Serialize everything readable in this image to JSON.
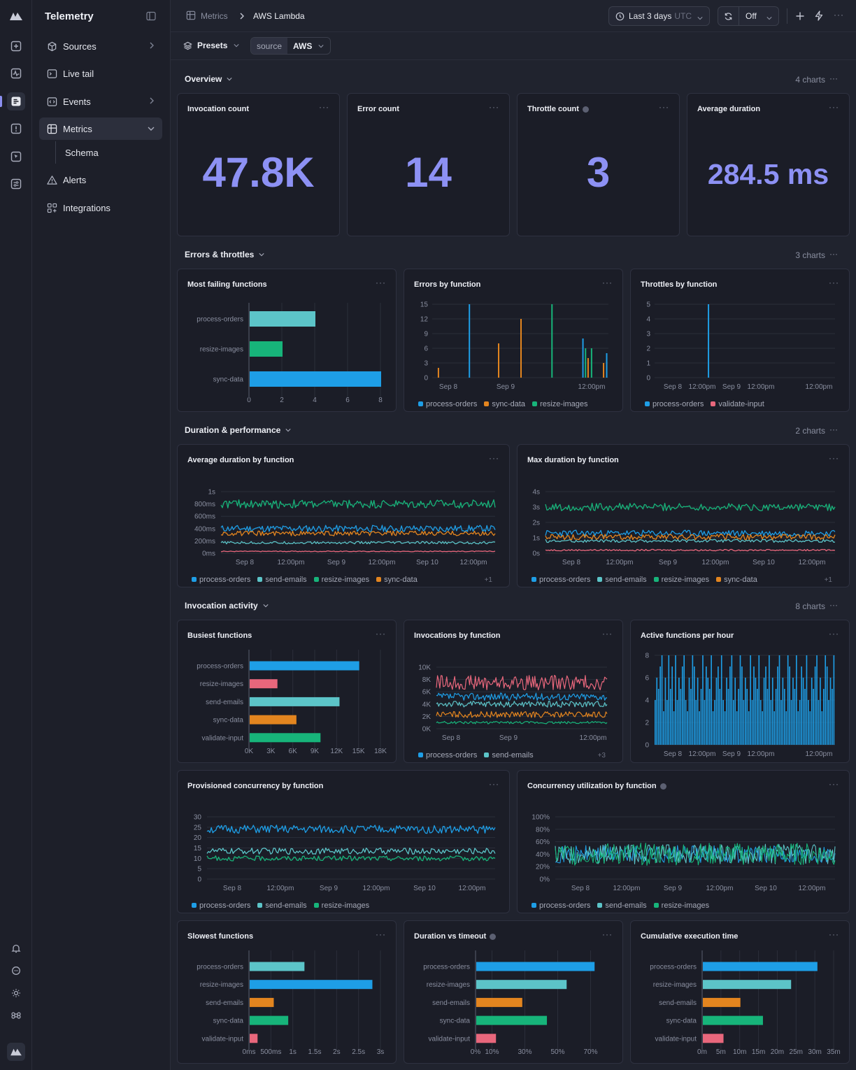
{
  "app": {
    "title": "Telemetry"
  },
  "sidebar": {
    "items": [
      {
        "label": "Sources",
        "icon": "cube-icon"
      },
      {
        "label": "Live tail",
        "icon": "terminal-icon"
      },
      {
        "label": "Events",
        "icon": "code-icon"
      },
      {
        "label": "Metrics",
        "icon": "grid-icon"
      },
      {
        "label": "Schema",
        "icon": ""
      },
      {
        "label": "Alerts",
        "icon": "alert-triangle-icon"
      },
      {
        "label": "Integrations",
        "icon": "integrations-icon"
      }
    ]
  },
  "header": {
    "breadcrumb": [
      "Metrics",
      "AWS Lambda"
    ],
    "time_range": "Last 3 days",
    "timezone": "UTC",
    "refresh": "Off"
  },
  "toolbar": {
    "presets": "Presets",
    "filter_key": "source",
    "filter_value": "AWS"
  },
  "sections": [
    {
      "title": "Overview",
      "count": "4 charts"
    },
    {
      "title": "Errors & throttles",
      "count": "3 charts"
    },
    {
      "title": "Duration & performance",
      "count": "2 charts"
    },
    {
      "title": "Invocation activity",
      "count": "8 charts"
    }
  ],
  "overview": [
    {
      "title": "Invocation count",
      "value": "47.8K"
    },
    {
      "title": "Error count",
      "value": "14"
    },
    {
      "title": "Throttle count",
      "value": "3"
    },
    {
      "title": "Average duration",
      "value": "284.5 ms"
    }
  ],
  "colors": {
    "process-orders": "#1e9ee6",
    "send-emails": "#5cc4c8",
    "resize-images": "#17b47a",
    "sync-data": "#e3851f",
    "validate-input": "#e8677c",
    "accent": "#8d91f4"
  },
  "cards": {
    "most_failing": {
      "title": "Most failing functions"
    },
    "errors_by_fn": {
      "title": "Errors by function"
    },
    "throttles_by_fn": {
      "title": "Throttles by function"
    },
    "avg_duration": {
      "title": "Average duration by function",
      "more": "+1"
    },
    "max_duration": {
      "title": "Max duration by function",
      "more": "+1"
    },
    "busiest": {
      "title": "Busiest functions"
    },
    "invocations_by_fn": {
      "title": "Invocations by function",
      "more": "+3"
    },
    "active_per_hour": {
      "title": "Active functions per hour"
    },
    "provisioned": {
      "title": "Provisioned concurrency by function"
    },
    "utilization": {
      "title": "Concurrency utilization by function"
    },
    "slowest": {
      "title": "Slowest functions"
    },
    "duration_vs_timeout": {
      "title": "Duration vs timeout"
    },
    "cumulative": {
      "title": "Cumulative execution time"
    }
  },
  "chart_data": [
    {
      "id": "most_failing",
      "type": "bar",
      "orientation": "horizontal",
      "categories": [
        "process-orders",
        "resize-images",
        "sync-data"
      ],
      "values": [
        4,
        2,
        8
      ],
      "colors": [
        "#5cc4c8",
        "#17b47a",
        "#1e9ee6"
      ],
      "xticks": [
        "0",
        "2",
        "4",
        "6",
        "8"
      ],
      "xlim": [
        0,
        8
      ]
    },
    {
      "id": "errors_by_fn",
      "type": "bar",
      "series_names": [
        "process-orders",
        "sync-data",
        "resize-images"
      ],
      "yticks": [
        "0",
        "3",
        "6",
        "9",
        "12",
        "15"
      ],
      "ylim": [
        0,
        15
      ],
      "xticks": [
        "Sep 8",
        "Sep 9",
        "12:00pm"
      ],
      "spikes": [
        {
          "t": 0.02,
          "v": 2,
          "s": "sync-data"
        },
        {
          "t": 0.2,
          "v": 15,
          "s": "process-orders"
        },
        {
          "t": 0.37,
          "v": 7,
          "s": "sync-data"
        },
        {
          "t": 0.5,
          "v": 12,
          "s": "sync-data"
        },
        {
          "t": 0.68,
          "v": 15,
          "s": "resize-images"
        },
        {
          "t": 0.86,
          "v": 8,
          "s": "process-orders"
        },
        {
          "t": 0.875,
          "v": 6,
          "s": "resize-images"
        },
        {
          "t": 0.89,
          "v": 4,
          "s": "sync-data"
        },
        {
          "t": 0.91,
          "v": 6,
          "s": "resize-images"
        },
        {
          "t": 0.98,
          "v": 3,
          "s": "sync-data"
        },
        {
          "t": 0.998,
          "v": 5,
          "s": "process-orders"
        }
      ]
    },
    {
      "id": "throttles_by_fn",
      "type": "bar",
      "series_names": [
        "process-orders",
        "validate-input"
      ],
      "yticks": [
        "0",
        "1",
        "2",
        "3",
        "4",
        "5"
      ],
      "ylim": [
        0,
        5
      ],
      "xticks": [
        "Sep 8",
        "12:00pm",
        "Sep 9",
        "12:00pm",
        "12:00pm"
      ],
      "spikes": [
        {
          "t": 0.29,
          "v": 5,
          "s": "process-orders"
        }
      ]
    },
    {
      "id": "avg_duration",
      "type": "line",
      "series": [
        {
          "name": "process-orders",
          "mean": 400,
          "amp": 55
        },
        {
          "name": "send-emails",
          "mean": 170,
          "amp": 20
        },
        {
          "name": "resize-images",
          "mean": 800,
          "amp": 70
        },
        {
          "name": "sync-data",
          "mean": 320,
          "amp": 40
        },
        {
          "name": "validate-input",
          "mean": 30,
          "amp": 6
        }
      ],
      "yticks": [
        "0ms",
        "200ms",
        "400ms",
        "600ms",
        "800ms",
        "1s"
      ],
      "ylim": [
        0,
        1000
      ],
      "xticks": [
        "Sep 8",
        "12:00pm",
        "Sep 9",
        "12:00pm",
        "Sep 10",
        "12:00pm"
      ]
    },
    {
      "id": "max_duration",
      "type": "line",
      "series": [
        {
          "name": "process-orders",
          "mean": 1.3,
          "amp": 0.2
        },
        {
          "name": "send-emails",
          "mean": 0.8,
          "amp": 0.1
        },
        {
          "name": "resize-images",
          "mean": 3.0,
          "amp": 0.25
        },
        {
          "name": "sync-data",
          "mean": 1.05,
          "amp": 0.18
        },
        {
          "name": "validate-input",
          "mean": 0.2,
          "amp": 0.05
        }
      ],
      "yticks": [
        "0s",
        "1s",
        "2s",
        "3s",
        "4s"
      ],
      "ylim": [
        0,
        4
      ],
      "xticks": [
        "Sep 8",
        "12:00pm",
        "Sep 9",
        "12:00pm",
        "Sep 10",
        "12:00pm"
      ]
    },
    {
      "id": "busiest",
      "type": "bar",
      "orientation": "horizontal",
      "categories": [
        "process-orders",
        "resize-images",
        "send-emails",
        "sync-data",
        "validate-input"
      ],
      "values": [
        15000,
        3800,
        12300,
        6400,
        9700
      ],
      "colors": [
        "#1e9ee6",
        "#e8677c",
        "#5cc4c8",
        "#e3851f",
        "#17b47a"
      ],
      "xticks": [
        "0K",
        "3K",
        "6K",
        "9K",
        "12K",
        "15K",
        "18K"
      ],
      "xlim": [
        0,
        18000
      ]
    },
    {
      "id": "invocations_by_fn",
      "type": "line",
      "series": [
        {
          "name": "process-orders",
          "mean": 5200,
          "amp": 600
        },
        {
          "name": "send-emails",
          "mean": 4000,
          "amp": 500
        },
        {
          "name": "resize-images",
          "mean": 1000,
          "amp": 200
        },
        {
          "name": "sync-data",
          "mean": 2300,
          "amp": 500
        },
        {
          "name": "validate-input",
          "mean": 7500,
          "amp": 1200
        }
      ],
      "yticks": [
        "0K",
        "2K",
        "4K",
        "6K",
        "8K",
        "10K"
      ],
      "ylim": [
        0,
        10000
      ],
      "xticks": [
        "Sep 8",
        "Sep 9",
        "12:00pm"
      ]
    },
    {
      "id": "active_per_hour",
      "type": "bar",
      "yticks": [
        "0",
        "2",
        "4",
        "6",
        "8"
      ],
      "ylim": [
        0,
        8
      ],
      "xticks": [
        "Sep 8",
        "12:00pm",
        "Sep 9",
        "12:00pm",
        "12:00pm"
      ],
      "values": [
        4,
        6,
        5,
        7,
        8,
        3,
        6,
        4,
        8,
        5,
        7,
        3,
        8,
        4,
        6,
        5,
        7,
        8,
        4,
        3,
        6,
        5,
        8,
        7,
        4,
        6,
        3,
        5,
        8,
        4,
        7,
        6,
        5,
        8,
        3,
        4,
        6,
        7,
        5,
        8,
        4,
        3,
        6,
        5,
        7,
        8,
        4,
        6,
        3,
        5,
        8,
        7,
        4,
        6,
        5,
        3,
        8,
        4,
        7,
        6,
        5,
        8,
        4,
        3,
        6,
        7,
        5,
        8,
        4,
        6,
        3,
        5,
        7,
        8,
        4,
        6,
        5,
        3,
        8,
        7,
        4,
        6,
        5,
        8,
        3,
        4,
        7,
        6,
        5,
        8,
        4,
        3,
        6,
        5,
        7,
        8,
        4,
        6,
        3,
        5,
        8,
        7,
        4,
        6,
        5,
        8
      ]
    },
    {
      "id": "provisioned",
      "type": "line",
      "series": [
        {
          "name": "process-orders",
          "mean": 24,
          "amp": 2
        },
        {
          "name": "send-emails",
          "mean": 13.5,
          "amp": 1.5
        },
        {
          "name": "resize-images",
          "mean": 10,
          "amp": 1.2
        }
      ],
      "yticks": [
        "0",
        "5",
        "10",
        "15",
        "20",
        "25",
        "30"
      ],
      "ylim": [
        0,
        30
      ],
      "xticks": [
        "Sep 8",
        "12:00pm",
        "Sep 9",
        "12:00pm",
        "Sep 10",
        "12:00pm"
      ]
    },
    {
      "id": "utilization",
      "type": "line",
      "series": [
        {
          "name": "process-orders",
          "mean": 40,
          "amp": 14
        },
        {
          "name": "send-emails",
          "mean": 40,
          "amp": 16
        },
        {
          "name": "resize-images",
          "mean": 40,
          "amp": 18
        }
      ],
      "yticks": [
        "0%",
        "20%",
        "40%",
        "60%",
        "80%",
        "100%"
      ],
      "ylim": [
        0,
        100
      ],
      "xticks": [
        "Sep 8",
        "12:00pm",
        "Sep 9",
        "12:00pm",
        "Sep 10",
        "12:00pm"
      ]
    },
    {
      "id": "slowest",
      "type": "bar",
      "orientation": "horizontal",
      "categories": [
        "process-orders",
        "resize-images",
        "send-emails",
        "sync-data",
        "validate-input"
      ],
      "values": [
        1.25,
        2.8,
        0.55,
        0.88,
        0.18
      ],
      "colors": [
        "#5cc4c8",
        "#1e9ee6",
        "#e3851f",
        "#17b47a",
        "#e8677c"
      ],
      "xticks": [
        "0ms",
        "500ms",
        "1s",
        "1.5s",
        "2s",
        "2.5s",
        "3s"
      ],
      "xlim": [
        0,
        3
      ]
    },
    {
      "id": "duration_vs_timeout",
      "type": "bar",
      "orientation": "horizontal",
      "categories": [
        "process-orders",
        "resize-images",
        "send-emails",
        "sync-data",
        "validate-input"
      ],
      "values": [
        72,
        55,
        28,
        43,
        12
      ],
      "colors": [
        "#1e9ee6",
        "#5cc4c8",
        "#e3851f",
        "#17b47a",
        "#e8677c"
      ],
      "xticks": [
        "0%",
        "10%",
        "30%",
        "50%",
        "70%"
      ],
      "xtick_values": [
        0,
        10,
        30,
        50,
        70
      ],
      "xlim": [
        0,
        80
      ]
    },
    {
      "id": "cumulative",
      "type": "bar",
      "orientation": "horizontal",
      "categories": [
        "process-orders",
        "resize-images",
        "send-emails",
        "sync-data",
        "validate-input"
      ],
      "values": [
        30.5,
        23.5,
        10,
        16,
        5.5
      ],
      "colors": [
        "#1e9ee6",
        "#5cc4c8",
        "#e3851f",
        "#17b47a",
        "#e8677c"
      ],
      "xticks": [
        "0m",
        "5m",
        "10m",
        "15m",
        "20m",
        "25m",
        "30m",
        "35m"
      ],
      "xlim": [
        0,
        35
      ]
    }
  ]
}
